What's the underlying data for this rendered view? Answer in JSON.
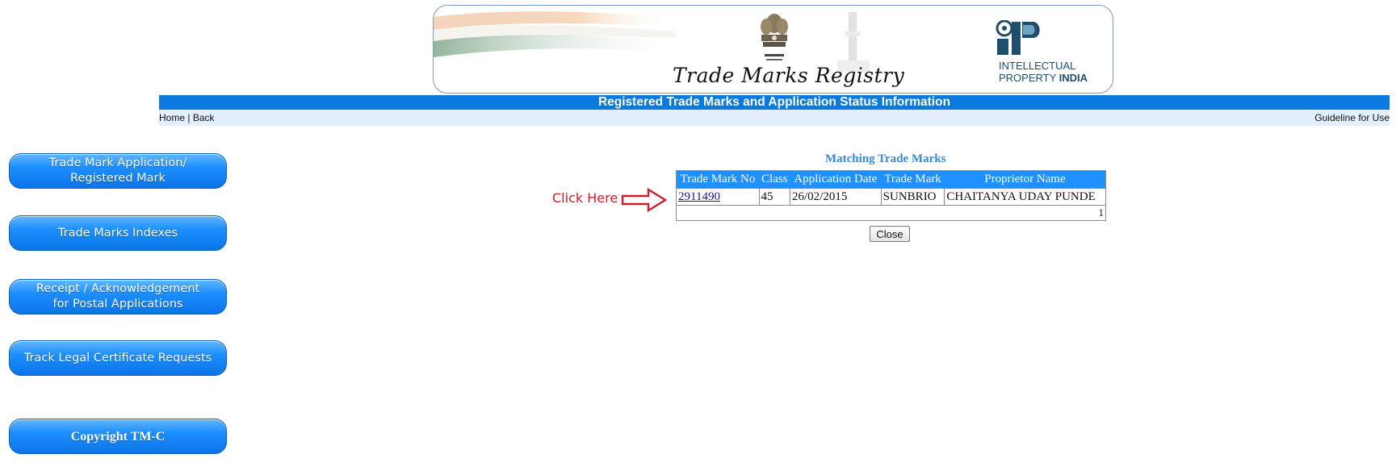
{
  "header": {
    "brand_title": "Trade Marks Registry",
    "ip_line1": "INTELLECTUAL",
    "ip_line2_a": "PROPERTY ",
    "ip_line2_b": "INDIA"
  },
  "titlebar": {
    "text": "Registered Trade Marks and Application Status Information"
  },
  "nav": {
    "home": "Home",
    "separator": " | ",
    "back": "Back",
    "guideline": "Guideline for Use"
  },
  "sidebar": {
    "buttons": [
      {
        "line1": "Trade Mark Application/",
        "line2": "Registered Mark"
      },
      {
        "line1": "Trade Marks Indexes",
        "line2": ""
      },
      {
        "line1": "Receipt / Acknowledgement",
        "line2": "for Postal Applications"
      },
      {
        "line1": "Track Legal Certificate Requests",
        "line2": ""
      },
      {
        "line1": "Copyright TM-C",
        "line2": ""
      }
    ]
  },
  "results": {
    "title": "Matching Trade Marks",
    "columns": [
      "Trade Mark No",
      "Class",
      "Application Date",
      "Trade Mark",
      "Proprietor Name"
    ],
    "rows": [
      {
        "tm_no": "2911490",
        "class": "45",
        "app_date": "26/02/2015",
        "trade_mark": "SUNBRIO",
        "proprietor": "CHAITANYA UDAY PUNDE"
      }
    ],
    "page": "1"
  },
  "annotation": {
    "text": "Click Here"
  },
  "buttons": {
    "close": "Close"
  },
  "colors": {
    "titlebar": "#0a7ae0",
    "button_blue": "#1e90ff",
    "annotation_red": "#c8202a"
  }
}
